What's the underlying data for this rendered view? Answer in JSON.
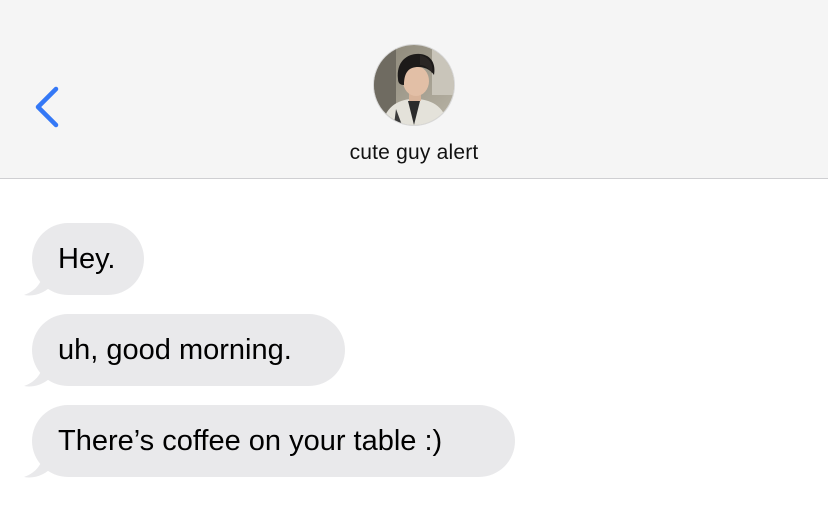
{
  "header": {
    "contact_name": "cute guy alert",
    "back_icon": "chevron-left-icon",
    "accent_color": "#3478f6",
    "background_color": "#f5f5f5"
  },
  "messages": [
    {
      "direction": "incoming",
      "text": "Hey."
    },
    {
      "direction": "incoming",
      "text": "uh, good morning."
    },
    {
      "direction": "incoming",
      "text": "There’s coffee on your table :)"
    }
  ],
  "colors": {
    "incoming_bubble": "#e9e9eb",
    "incoming_text": "#000000"
  }
}
